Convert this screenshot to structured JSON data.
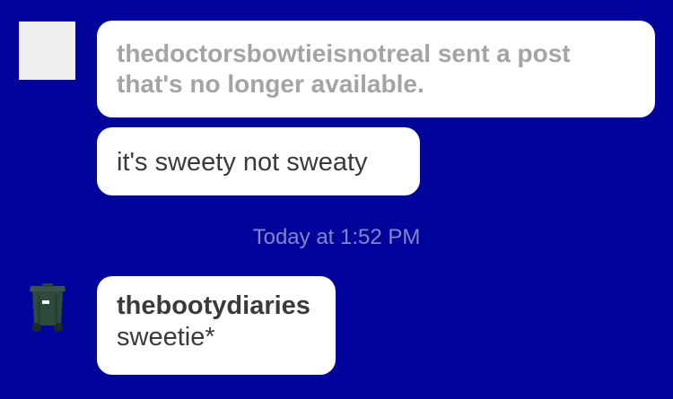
{
  "messages": [
    {
      "text": "thedoctorsbowtieisnotreal sent a post that's no longer available."
    },
    {
      "text": "it's sweety not sweaty"
    }
  ],
  "timestamp": "Today at 1:52 PM",
  "reply": {
    "username": "thebootydiaries",
    "text": "sweetie*"
  },
  "icons": {
    "sender_avatar": "avatar-placeholder",
    "reply_avatar": "trash-bin-icon"
  },
  "colors": {
    "background": "#01049a",
    "bubble": "#ffffff",
    "system_text": "#a4a4a4",
    "message_text": "#3a3a3a",
    "timestamp": "#8186c9",
    "bin_green": "#2e4a3b"
  }
}
